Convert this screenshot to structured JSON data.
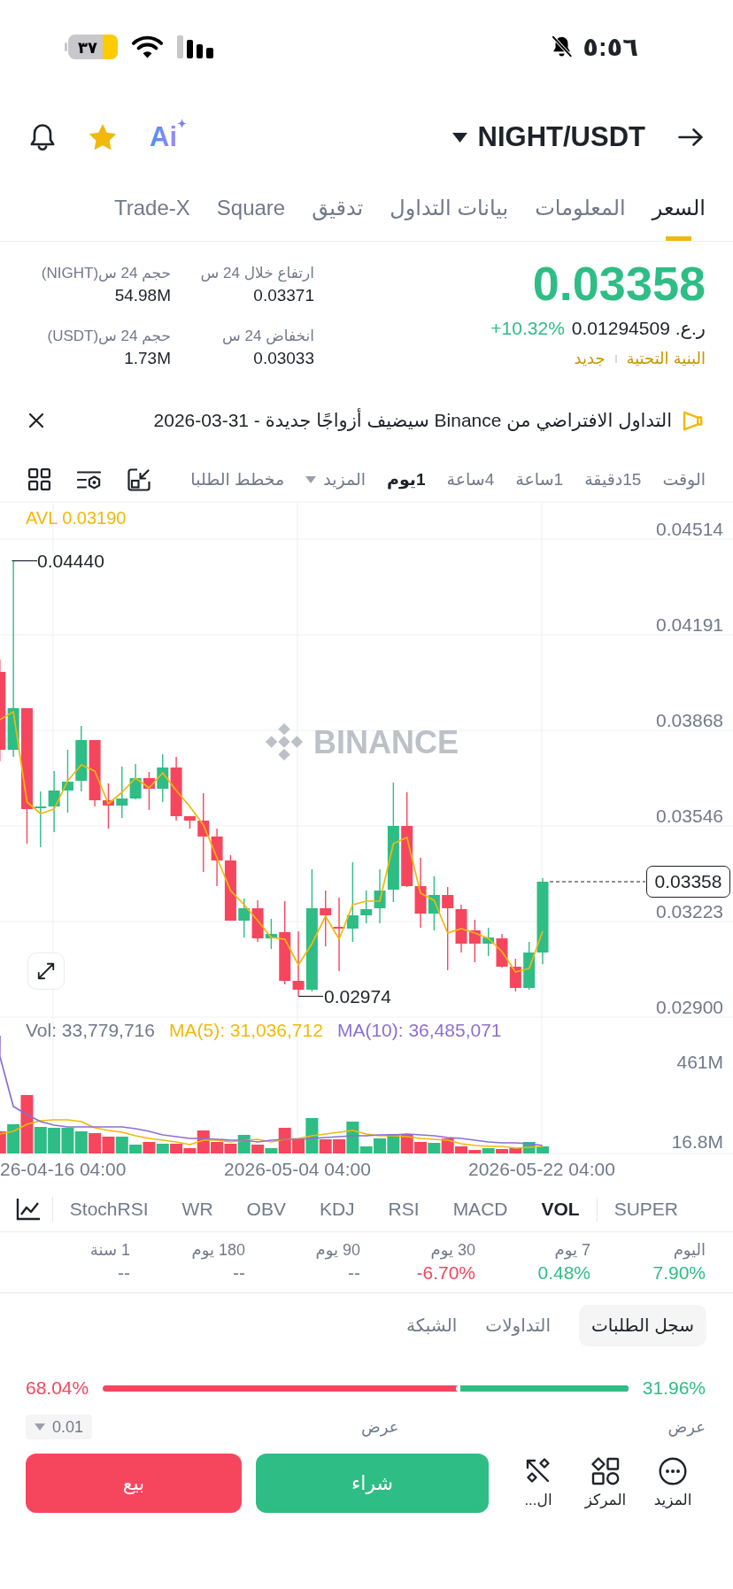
{
  "status_bar": {
    "time": "٥:٥٦",
    "battery": "٣٧"
  },
  "header": {
    "pair": "NIGHT/USDT",
    "ai_label": "Ai",
    "favorite": true
  },
  "tabs": [
    {
      "label": "السعر",
      "selected": true
    },
    {
      "label": "المعلومات",
      "selected": false
    },
    {
      "label": "بيانات التداول",
      "selected": false
    },
    {
      "label": "تدقيق",
      "selected": false
    },
    {
      "label": "Square",
      "selected": false
    },
    {
      "label": "Trade-X",
      "selected": false
    }
  ],
  "ticker": {
    "last_price": "0.03358",
    "fiat_price": "ر.ع. 0.01294509",
    "change": "+10.32%",
    "rising": true,
    "tags": [
      "البنية التحتية",
      "جديد"
    ],
    "stats": [
      {
        "label": "ارتفاع خلال 24 س",
        "value": "0.03371"
      },
      {
        "label": "حجم 24 س(NIGHT)",
        "value": "54.98M"
      },
      {
        "label": "انخفاض 24 س",
        "value": "0.03033"
      },
      {
        "label": "حجم 24 س(USDT)",
        "value": "1.73M"
      }
    ]
  },
  "announcement": {
    "text": "التداول الافتراضي من Binance سيضيف أزواجًا جديدة - 31-03-2026"
  },
  "intervals": {
    "label": "الوقت",
    "options": [
      {
        "label": "15دقيقة",
        "selected": false
      },
      {
        "label": "1ساعة",
        "selected": false
      },
      {
        "label": "4ساعة",
        "selected": false
      },
      {
        "label": "1يوم",
        "selected": true
      }
    ],
    "more": "المزيد",
    "depth_chart": "مخطط الطلبا"
  },
  "chart": {
    "avl": "AVL 0.03190",
    "watermark": "BINANCE",
    "price_ticks": [
      "0.04514",
      "0.04191",
      "0.03868",
      "0.03546",
      "0.03223",
      "0.02900"
    ],
    "high_label": "0.04440",
    "low_label": "0.02974",
    "last_price": "0.03358",
    "volume_legend": [
      {
        "label": "MA(10): 36,485,071",
        "color": "#8d6fd1"
      },
      {
        "label": "MA(5): 31,036,712",
        "color": "#f0b90b"
      },
      {
        "label": "Vol: 33,779,716",
        "color": "#707a8a"
      }
    ],
    "volume_ticks": [
      "461M",
      "16.8M"
    ],
    "dates": [
      "2026-05-22 04:00",
      "2026-05-04 04:00",
      "26-04-16 04:00"
    ]
  },
  "indicators": {
    "main": [
      {
        "label": "SUPER",
        "selected": false
      }
    ],
    "sub": [
      {
        "label": "VOL",
        "selected": true
      },
      {
        "label": "MACD",
        "selected": false
      },
      {
        "label": "RSI",
        "selected": false
      },
      {
        "label": "KDJ",
        "selected": false
      },
      {
        "label": "OBV",
        "selected": false
      },
      {
        "label": "WR",
        "selected": false
      },
      {
        "label": "StochRSI",
        "selected": false
      }
    ]
  },
  "performance": [
    {
      "period": "اليوم",
      "change": "7.90%",
      "kind": "up"
    },
    {
      "period": "7 يوم",
      "change": "0.48%",
      "kind": "up"
    },
    {
      "period": "30 يوم",
      "change": "-6.70%",
      "kind": "down"
    },
    {
      "period": "90 يوم",
      "change": "--",
      "kind": "none"
    },
    {
      "period": "180 يوم",
      "change": "--",
      "kind": "none"
    },
    {
      "period": "1 سنة",
      "change": "--",
      "kind": "none"
    }
  ],
  "order_book": {
    "tabs": [
      {
        "label": "سجل الطلبات",
        "selected": true
      },
      {
        "label": "التداولات",
        "selected": false
      },
      {
        "label": "الشبكة",
        "selected": false
      }
    ],
    "buy_ratio": "31.96%",
    "sell_ratio": "68.04%",
    "level": 0.3196,
    "precision": "0.01",
    "columns": [
      "عرض",
      "عرض"
    ]
  },
  "actions": {
    "shortcuts": [
      {
        "label": "المزيد",
        "kind": "more"
      },
      {
        "label": "المركز",
        "kind": "center"
      },
      {
        "label": "ال...",
        "kind": "tools"
      }
    ],
    "buttons": [
      {
        "label": "شراء",
        "kind": "buy"
      },
      {
        "label": "بيع",
        "kind": "sell"
      }
    ]
  }
}
